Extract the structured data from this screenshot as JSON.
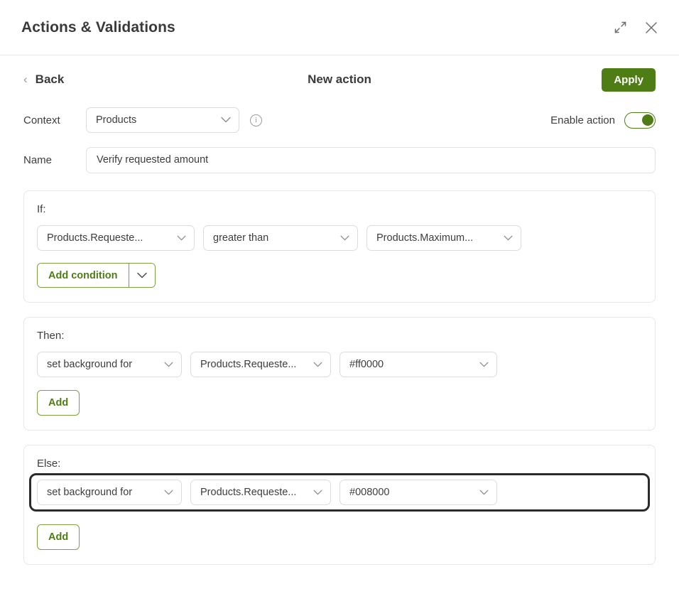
{
  "header": {
    "title": "Actions & Validations",
    "expand_icon": "expand-diagonal-icon",
    "close_icon": "close-icon"
  },
  "nav": {
    "back_label": "Back",
    "back_chevron": "chevron-left-icon",
    "title": "New action",
    "apply_label": "Apply"
  },
  "context": {
    "label": "Context",
    "value": "Products",
    "caret": "chevron-down-icon",
    "info_icon": "info-icon",
    "info_glyph": "i",
    "enable_label": "Enable action",
    "enable_on": true
  },
  "name": {
    "label": "Name",
    "value": "Verify requested amount",
    "placeholder": "Name"
  },
  "if_block": {
    "label": "If:",
    "field": "Products.Requeste...",
    "operator": "greater than",
    "compare_to": "Products.Maximum...",
    "add_condition_label": "Add condition",
    "add_condition_caret": "chevron-down-icon"
  },
  "then_block": {
    "label": "Then:",
    "action": "set background for",
    "target": "Products.Requeste...",
    "value": "#ff0000",
    "add_label": "Add"
  },
  "else_block": {
    "label": "Else:",
    "action": "set background for",
    "target": "Products.Requeste...",
    "value": "#008000",
    "add_label": "Add",
    "focused": true
  },
  "colors": {
    "accent_green": "#4f7d15",
    "border_green": "#7ba141",
    "focus_ring": "#2b2b2b",
    "panel_border": "#e6e6e6",
    "text": "#3d3d3d",
    "then_color_value": "#ff0000",
    "else_color_value": "#008000"
  }
}
